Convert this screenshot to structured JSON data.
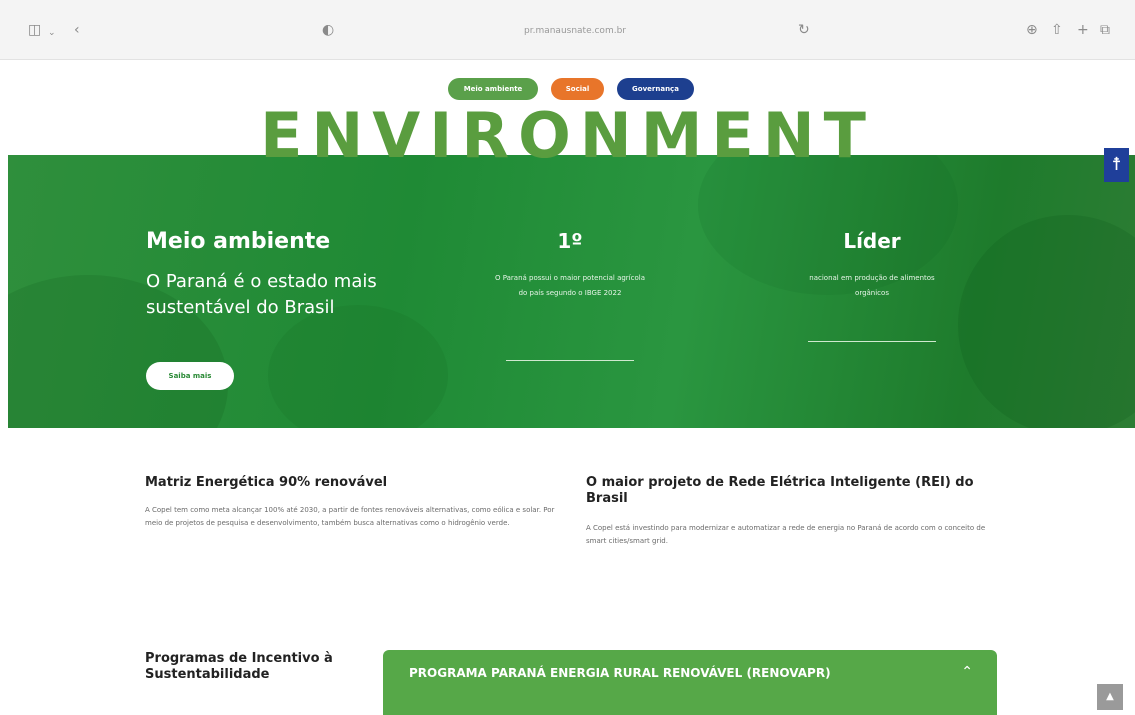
{
  "browser": {
    "url": "pr.manausnate.com.br",
    "icons": {
      "sidebar": "sidebar-icon",
      "back": "chevron-left-icon",
      "privacy": "shield-icon",
      "reload": "reload-icon",
      "download": "download-icon",
      "share": "share-icon",
      "new_tab": "plus-icon",
      "tabs": "tabs-icon"
    }
  },
  "tabs_pills": [
    {
      "label": "Meio ambiente",
      "color": "#5aa04a"
    },
    {
      "label": "Social",
      "color": "#e8752a"
    },
    {
      "label": "Governança",
      "color": "#1d3f8f"
    }
  ],
  "hero": {
    "big_word": "ENVIRONMENT",
    "title": "Meio ambiente",
    "subtitle": "O Paraná é o estado mais sustentável do Brasil",
    "button_label": "Saiba mais",
    "stat1_value": "1º",
    "stat1_text": "O Paraná possui o maior potencial agrícola do país segundo o IBGE 2022",
    "stat2_value": "Líder",
    "stat2_text": "nacional em produção de alimentos orgânicos",
    "accent_color": "#2a8f3c"
  },
  "accessibility_button": {
    "icon": "accessibility-icon"
  },
  "content": {
    "left_title": "Matriz Energética 90% renovável",
    "left_text": "A Copel tem como meta alcançar 100% até 2030, a partir de fontes renováveis alternativas, como eólica e solar. Por meio de projetos de pesquisa e desenvolvimento, também busca alternativas como o hidrogênio verde.",
    "right_title": "O maior projeto de Rede Elétrica Inteligente (REI) do Brasil",
    "right_text": "A Copel está investindo para modernizar e automatizar a rede de energia no Paraná de acordo com o conceito de smart cities/smart grid."
  },
  "programs": {
    "title": "Programas de Incentivo à Sustentabilidade",
    "accordion_label": "PROGRAMA PARANÁ ENERGIA RURAL RENOVÁVEL (RENOVAPR)",
    "accordion_icon": "chevron-up-icon"
  },
  "scroll_top": {
    "icon": "arrow-up-icon"
  }
}
